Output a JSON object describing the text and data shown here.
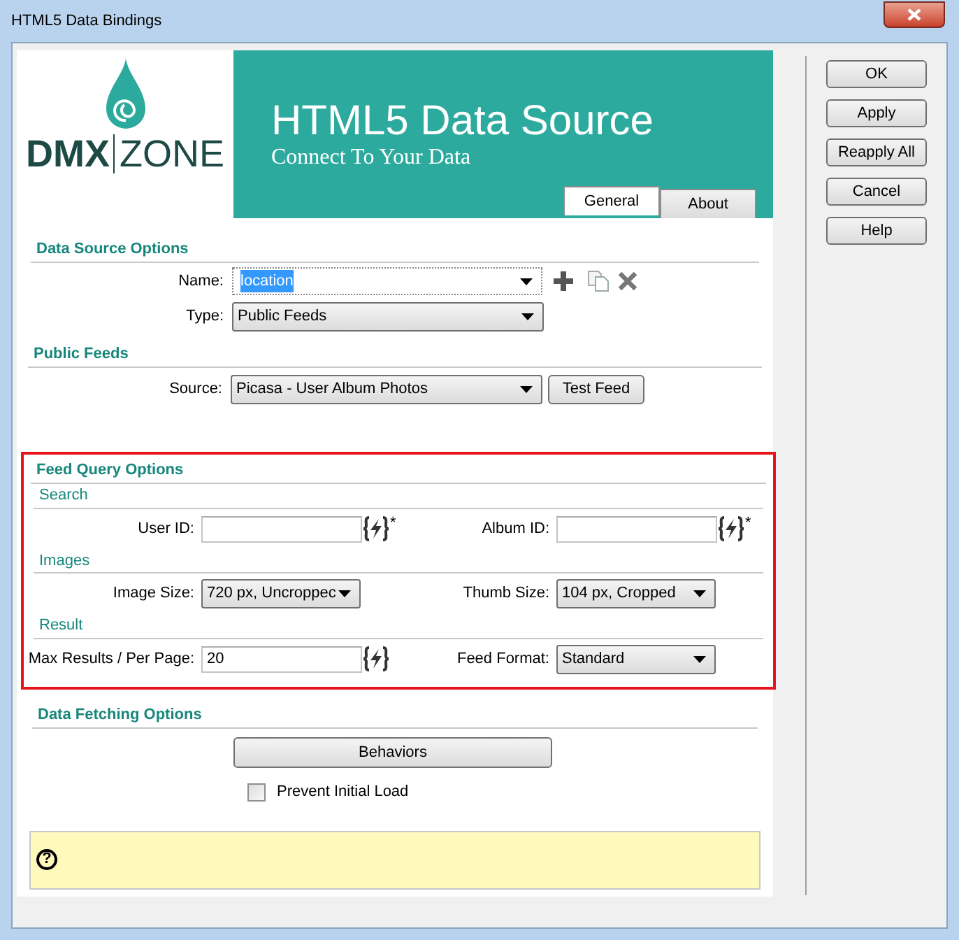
{
  "window": {
    "title": "HTML5 Data Bindings"
  },
  "header": {
    "logo": {
      "left": "DMX",
      "right": "ZONE"
    },
    "title": "HTML5 Data Source",
    "subtitle": "Connect To Your Data"
  },
  "tabs": [
    {
      "label": "General",
      "selected": true
    },
    {
      "label": "About",
      "selected": false
    }
  ],
  "data_source_options": {
    "title": "Data Source Options",
    "name": {
      "label": "Name:",
      "value": "location",
      "text_selected": true
    },
    "type": {
      "label": "Type:",
      "value": "Public Feeds"
    }
  },
  "public_feeds": {
    "title": "Public Feeds",
    "source": {
      "label": "Source:",
      "value": "Picasa - User Album Photos"
    },
    "test_button": "Test Feed"
  },
  "feed_query_options": {
    "title": "Feed Query Options",
    "highlighted": true,
    "groups": [
      {
        "title": "Search",
        "fields": [
          {
            "label": "User ID:",
            "kind": "input",
            "binding": true,
            "required_mark": "*"
          },
          {
            "label": "Album ID:",
            "kind": "input",
            "binding": true,
            "required_mark": "*"
          }
        ]
      },
      {
        "title": "Images",
        "fields": [
          {
            "label": "Image Size:",
            "kind": "select",
            "value": "720 px, Uncroppec"
          },
          {
            "label": "Thumb Size:",
            "kind": "select",
            "value": "104 px, Cropped"
          }
        ]
      },
      {
        "title": "Result",
        "fields": [
          {
            "label": "Max Results / Per Page:",
            "kind": "input",
            "value": "20",
            "binding": true
          },
          {
            "label": "Feed Format:",
            "kind": "select",
            "value": "Standard"
          }
        ]
      }
    ]
  },
  "data_fetching_options": {
    "title": "Data Fetching Options",
    "button": "Behaviors",
    "prevent_initial_load": {
      "label": "Prevent Initial Load",
      "checked": false
    }
  },
  "help_panel": {
    "icon": "?"
  },
  "buttons": [
    "OK",
    "Apply",
    "Reapply All",
    "Cancel",
    "Help"
  ]
}
